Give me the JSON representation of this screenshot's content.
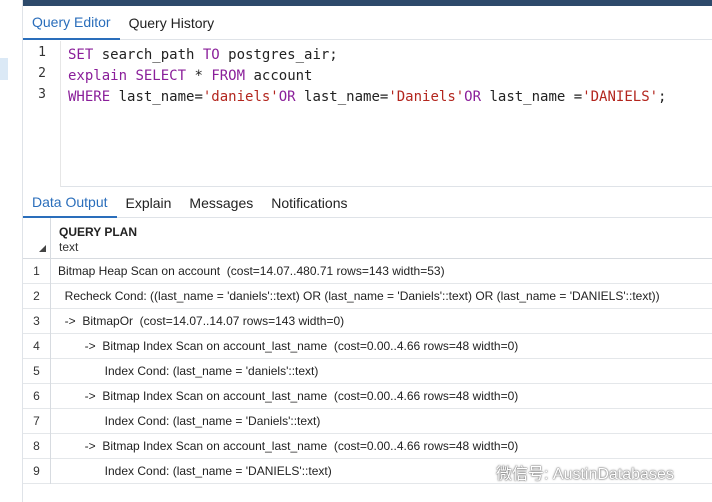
{
  "editor_tabs": [
    {
      "label": "Query Editor",
      "active": true
    },
    {
      "label": "Query History",
      "active": false
    }
  ],
  "editor": {
    "lines": [
      {
        "num": "1",
        "tokens": [
          {
            "t": "SET",
            "k": "kw"
          },
          {
            "t": " search_path ",
            "k": ""
          },
          {
            "t": "TO",
            "k": "kw"
          },
          {
            "t": " postgres_air;",
            "k": ""
          }
        ]
      },
      {
        "num": "2",
        "tokens": [
          {
            "t": "explain",
            "k": "kw"
          },
          {
            "t": " ",
            "k": ""
          },
          {
            "t": "SELECT",
            "k": "kw"
          },
          {
            "t": " * ",
            "k": ""
          },
          {
            "t": "FROM",
            "k": "kw"
          },
          {
            "t": " account",
            "k": ""
          }
        ]
      },
      {
        "num": "3",
        "tokens": [
          {
            "t": "WHERE",
            "k": "kw"
          },
          {
            "t": " last_name=",
            "k": ""
          },
          {
            "t": "'daniels'",
            "k": "str"
          },
          {
            "t": "OR",
            "k": "kw"
          },
          {
            "t": " last_name=",
            "k": ""
          },
          {
            "t": "'Daniels'",
            "k": "str"
          },
          {
            "t": "OR",
            "k": "kw"
          },
          {
            "t": " last_name =",
            "k": ""
          },
          {
            "t": "'DANIELS'",
            "k": "str"
          },
          {
            "t": ";",
            "k": ""
          }
        ]
      }
    ]
  },
  "output_tabs": [
    {
      "label": "Data Output",
      "active": true
    },
    {
      "label": "Explain",
      "active": false
    },
    {
      "label": "Messages",
      "active": false
    },
    {
      "label": "Notifications",
      "active": false
    }
  ],
  "grid": {
    "column_name": "QUERY PLAN",
    "column_type": "text",
    "rows": [
      {
        "num": "1",
        "text": "Bitmap Heap Scan on account  (cost=14.07..480.71 rows=143 width=53)"
      },
      {
        "num": "2",
        "text": "  Recheck Cond: ((last_name = 'daniels'::text) OR (last_name = 'Daniels'::text) OR (last_name = 'DANIELS'::text))"
      },
      {
        "num": "3",
        "text": "  ->  BitmapOr  (cost=14.07..14.07 rows=143 width=0)"
      },
      {
        "num": "4",
        "text": "        ->  Bitmap Index Scan on account_last_name  (cost=0.00..4.66 rows=48 width=0)"
      },
      {
        "num": "5",
        "text": "              Index Cond: (last_name = 'daniels'::text)"
      },
      {
        "num": "6",
        "text": "        ->  Bitmap Index Scan on account_last_name  (cost=0.00..4.66 rows=48 width=0)"
      },
      {
        "num": "7",
        "text": "              Index Cond: (last_name = 'Daniels'::text)"
      },
      {
        "num": "8",
        "text": "        ->  Bitmap Index Scan on account_last_name  (cost=0.00..4.66 rows=48 width=0)"
      },
      {
        "num": "9",
        "text": "              Index Cond: (last_name = 'DANIELS'::text)"
      }
    ]
  },
  "watermark": {
    "label": "微信号: AustinDatabases",
    "icon": "wechat-icon"
  },
  "colors": {
    "accent": "#2a6ebb",
    "keyword": "#8a1e9a",
    "string": "#b3261e"
  }
}
